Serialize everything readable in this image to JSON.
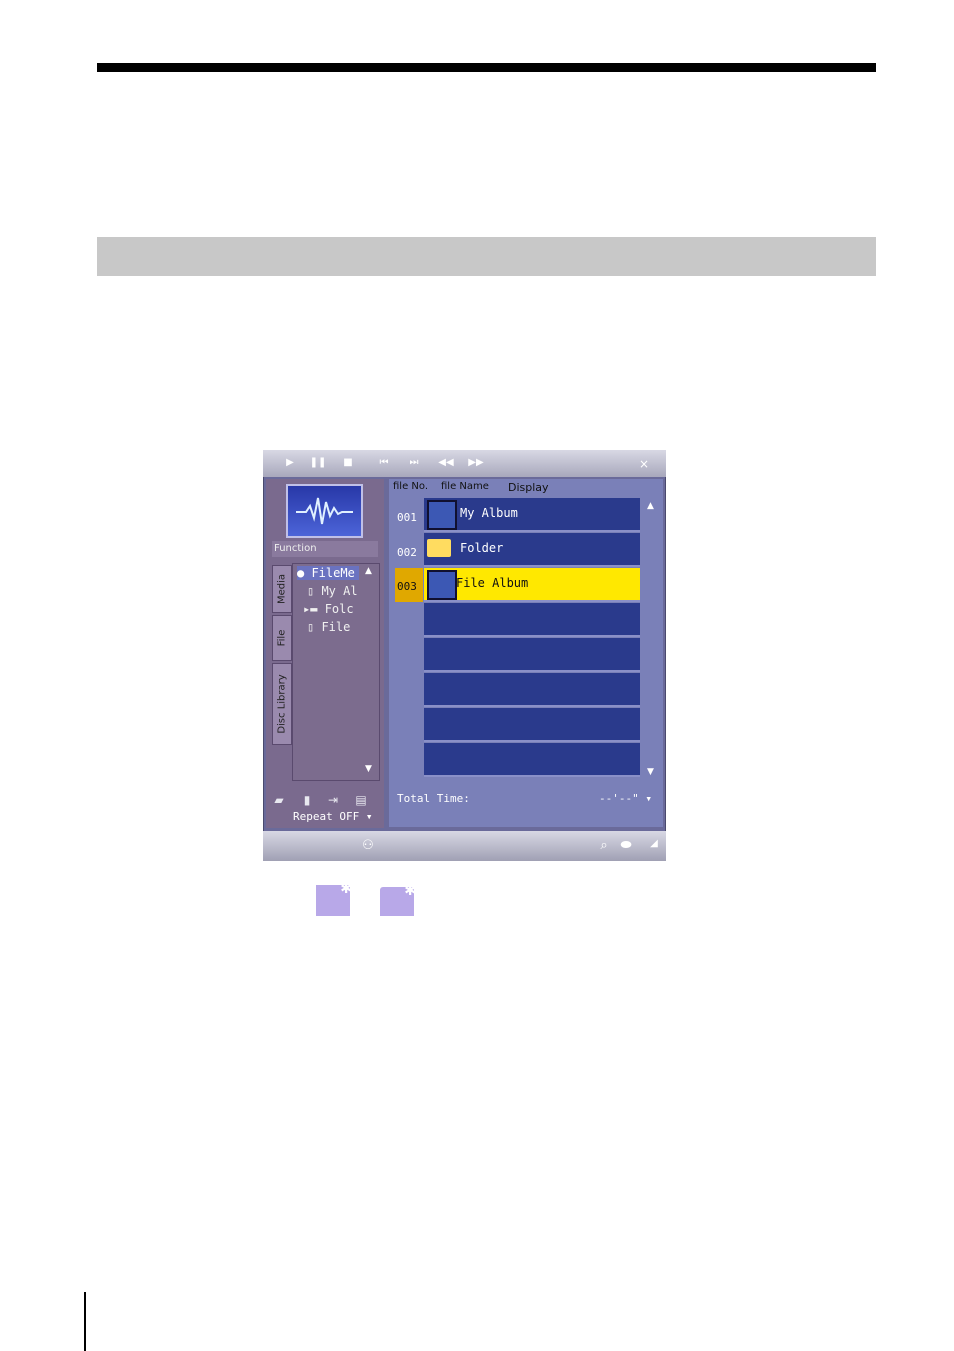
{
  "window": {
    "close_label": "×",
    "transport_icons": [
      "play-icon",
      "pause-icon",
      "stop-icon",
      "skip-back-icon",
      "skip-forward-icon",
      "rewind-icon",
      "fast-forward-icon"
    ]
  },
  "left_panel": {
    "function_label": "Function",
    "tabs": [
      "Media",
      "File",
      "Disc Library"
    ],
    "tree": [
      "FileMe",
      "My Al",
      "Folc",
      "File"
    ],
    "repeat_label": "Repeat  OFF"
  },
  "list": {
    "headers": [
      "file No.",
      "file Name",
      "Display"
    ],
    "rows": [
      {
        "num": "001",
        "name": "My Album",
        "kind": "album"
      },
      {
        "num": "002",
        "name": "Folder",
        "kind": "folder"
      },
      {
        "num": "003",
        "name": "File Album",
        "kind": "album",
        "selected": true
      }
    ],
    "total_time_label": "Total Time:",
    "total_time_value": "--'--\""
  },
  "colors": {
    "window_bg": "#6a6a9a",
    "row_bg": "#2a3a8c",
    "selected_row": "#ffe800",
    "selected_num": "#e0a800"
  }
}
